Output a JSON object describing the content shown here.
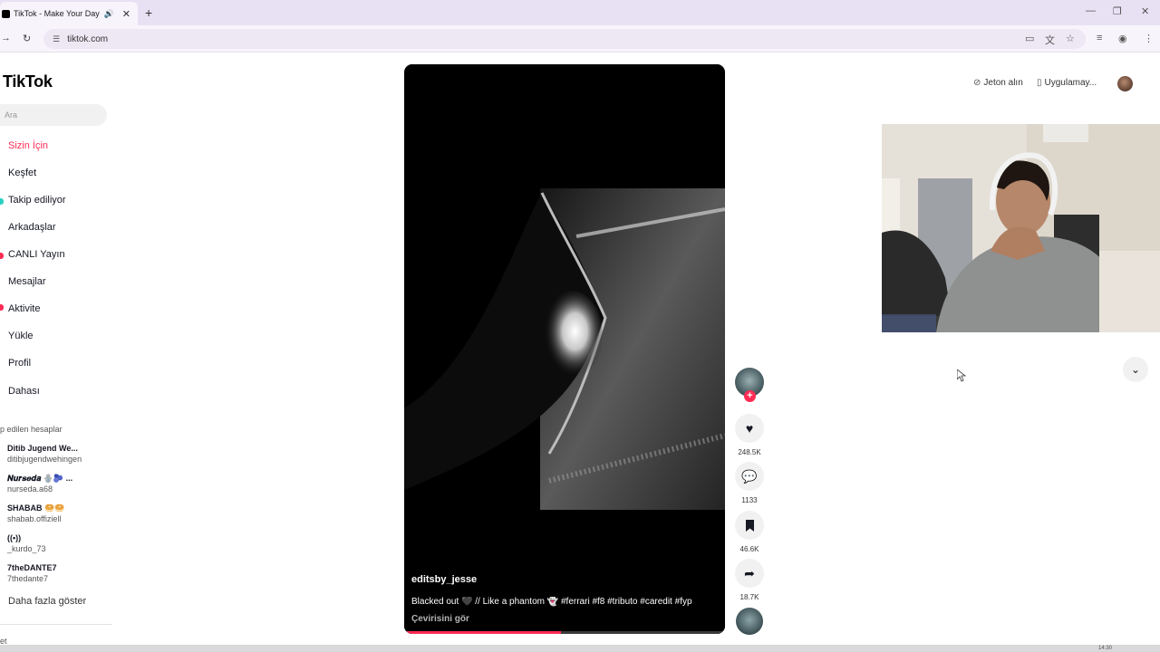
{
  "browser": {
    "tab_title": "TikTok - Make Your Day",
    "url": "tiktok.com"
  },
  "sidebar": {
    "logo": "TikTok",
    "search_placeholder": "Ara",
    "nav": [
      {
        "label": "Sizin İçin",
        "active": true
      },
      {
        "label": "Keşfet"
      },
      {
        "label": "Takip ediliyor"
      },
      {
        "label": "Arkadaşlar"
      },
      {
        "label": "CANLI Yayın"
      },
      {
        "label": "Mesajlar"
      },
      {
        "label": "Aktivite"
      },
      {
        "label": "Yükle"
      },
      {
        "label": "Profil"
      },
      {
        "label": "Dahası"
      }
    ],
    "followed_title": "p edilen hesaplar",
    "accounts": [
      {
        "name": "Ditib Jugend We...",
        "handle": "ditibjugendwehingen"
      },
      {
        "name": "𝑵𝒖𝒓𝒔𝒆𝒅𝒂 🪬🫐 ...",
        "handle": "nurseda.a68"
      },
      {
        "name": "SHABAB 🥯🥯",
        "handle": "shabab.offiziell"
      },
      {
        "name": "((•))",
        "handle": "_kurdo_73"
      },
      {
        "name": "7theDANTE7",
        "handle": "7thedante7"
      }
    ],
    "see_more": "Daha fazla göster",
    "cut_text": "et"
  },
  "video": {
    "author": "editsby_jesse",
    "caption": "Blacked out 🖤 // Like a phantom 👻 #ferrari #f8 #tributo #caredit #fyp",
    "translate": "Çevirisini gör",
    "progress": 0.49
  },
  "actions": {
    "likes": "248.5K",
    "comments": "1133",
    "saves": "46.6K",
    "shares": "18.7K"
  },
  "topbar": {
    "coins": "Jeton alın",
    "app": "Uygulamay..."
  },
  "taskbar": {
    "time": "14:30"
  },
  "colors": {
    "accent": "#fe2c55",
    "tab_strip": "#e8e0f3"
  }
}
